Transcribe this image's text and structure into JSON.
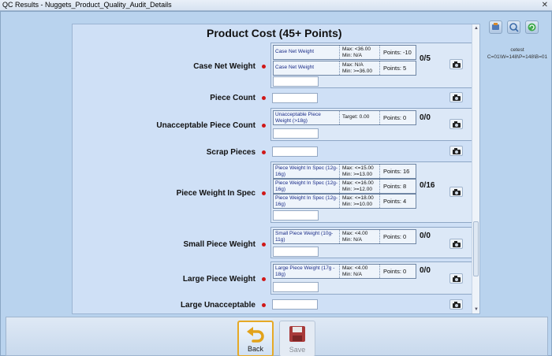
{
  "window": {
    "title": "QC Results - Nuggets_Product_Quality_Audit_Details",
    "close_glyph": "✕"
  },
  "section_title": "Product Cost (45+ Points)",
  "rows": [
    {
      "label": "Case Net Weight",
      "score": "0/5",
      "criteria": [
        {
          "name": "Case Net Weight",
          "range_line1": "Max: <36.00",
          "range_line2": "Min: N/A",
          "points": "Points: -10"
        },
        {
          "name": "Case Net Weight",
          "range_line1": "Max: N/A",
          "range_line2": "Min: >=36.00",
          "points": "Points: 5"
        }
      ]
    },
    {
      "label": "Piece Count",
      "score": "",
      "criteria": []
    },
    {
      "label": "Unacceptable Piece Count",
      "score": "0/0",
      "criteria": [
        {
          "name": "Unacceptable Piece Weight (>18g)",
          "range_line1": "Target: 0.00",
          "range_line2": "",
          "points": "Points: 0"
        }
      ]
    },
    {
      "label": "Scrap Pieces",
      "score": "",
      "criteria": []
    },
    {
      "label": "Piece Weight In Spec",
      "score": "0/16",
      "criteria": [
        {
          "name": "Piece Weight In Spec (12g-16g)",
          "range_line1": "Max: <=15.00",
          "range_line2": "Min: >=13.00",
          "points": "Points: 16"
        },
        {
          "name": "Piece Weight In Spec (12g-16g)",
          "range_line1": "Max: <=16.00",
          "range_line2": "Min: >=12.00",
          "points": "Points: 8"
        },
        {
          "name": "Piece Weight In Spec (12g-16g)",
          "range_line1": "Max: <=18.00",
          "range_line2": "Min: >=10.00",
          "points": "Points: 4"
        }
      ]
    },
    {
      "label": "Small Piece Weight",
      "score": "0/0",
      "criteria": [
        {
          "name": "Small Piece Weight (10g-11g)",
          "range_line1": "Max: <4.00",
          "range_line2": "Min: N/A",
          "points": "Points: 0"
        }
      ]
    },
    {
      "label": "Large Piece Weight",
      "score": "0/0",
      "criteria": [
        {
          "name": "Large Piece Weight (17g - 18g)",
          "range_line1": "Max: <4.00",
          "range_line2": "Min: N/A",
          "points": "Points: 0"
        }
      ]
    },
    {
      "label": "Large Unacceptable",
      "score": "",
      "criteria": []
    }
  ],
  "right_panel": {
    "user": "cetest",
    "status": "C=01\\W=148\\P=148\\B=01"
  },
  "toolbar": {
    "back_label": "Back",
    "save_label": "Save"
  },
  "icons": {
    "camera": "camera-icon",
    "back": "undo-arrow-icon",
    "save": "floppy-disk-icon"
  },
  "colors": {
    "required_dot": "#d01818",
    "criterion_text": "#1a2c88",
    "back_highlight": "#e6a926"
  }
}
